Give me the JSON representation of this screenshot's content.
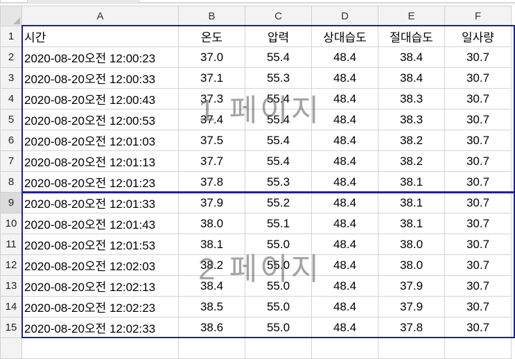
{
  "columns": [
    "A",
    "B",
    "C",
    "D",
    "E",
    "F"
  ],
  "header_row": {
    "row_number": "1",
    "cells": [
      "시간",
      "온도",
      "압력",
      "상대습도",
      "절대습도",
      "일사량"
    ]
  },
  "rows": [
    {
      "n": "2",
      "cells": [
        "2020-08-20오전  12:00:23",
        "37.0",
        "55.4",
        "48.4",
        "38.4",
        "30.7"
      ]
    },
    {
      "n": "3",
      "cells": [
        "2020-08-20오전  12:00:33",
        "37.1",
        "55.3",
        "48.4",
        "38.4",
        "30.7"
      ]
    },
    {
      "n": "4",
      "cells": [
        "2020-08-20오전  12:00:43",
        "37.3",
        "55.4",
        "48.4",
        "38.3",
        "30.7"
      ]
    },
    {
      "n": "5",
      "cells": [
        "2020-08-20오전  12:00:53",
        "37.4",
        "55.4",
        "48.4",
        "38.3",
        "30.7"
      ]
    },
    {
      "n": "6",
      "cells": [
        "2020-08-20오전  12:01:03",
        "37.5",
        "55.4",
        "48.4",
        "38.2",
        "30.7"
      ]
    },
    {
      "n": "7",
      "cells": [
        "2020-08-20오전  12:01:13",
        "37.7",
        "55.4",
        "48.4",
        "38.2",
        "30.7"
      ]
    },
    {
      "n": "8",
      "cells": [
        "2020-08-20오전  12:01:23",
        "37.8",
        "55.3",
        "48.4",
        "38.1",
        "30.7"
      ]
    },
    {
      "n": "9",
      "cells": [
        "2020-08-20오전  12:01:33",
        "37.9",
        "55.2",
        "48.4",
        "38.1",
        "30.7"
      ]
    },
    {
      "n": "10",
      "cells": [
        "2020-08-20오전  12:01:43",
        "38.0",
        "55.1",
        "48.4",
        "38.1",
        "30.7"
      ]
    },
    {
      "n": "11",
      "cells": [
        "2020-08-20오전  12:01:53",
        "38.1",
        "55.0",
        "48.4",
        "38.0",
        "30.7"
      ]
    },
    {
      "n": "12",
      "cells": [
        "2020-08-20오전  12:02:03",
        "38.2",
        "55.0",
        "48.4",
        "38.0",
        "30.7"
      ]
    },
    {
      "n": "13",
      "cells": [
        "2020-08-20오전  12:02:13",
        "38.4",
        "55.0",
        "48.4",
        "37.9",
        "30.7"
      ]
    },
    {
      "n": "14",
      "cells": [
        "2020-08-20오전  12:02:23",
        "38.5",
        "55.0",
        "48.4",
        "37.9",
        "30.7"
      ]
    },
    {
      "n": "15",
      "cells": [
        "2020-08-20오전  12:02:33",
        "38.6",
        "55.0",
        "48.4",
        "37.8",
        "30.7"
      ]
    }
  ],
  "watermarks": [
    "1 페이지",
    "2 페이지"
  ],
  "selected_row": "9",
  "colors": {
    "page_break": "#1f1f9e",
    "header_bg": "#f3f3f3",
    "grid_line": "#d4d4d4"
  }
}
